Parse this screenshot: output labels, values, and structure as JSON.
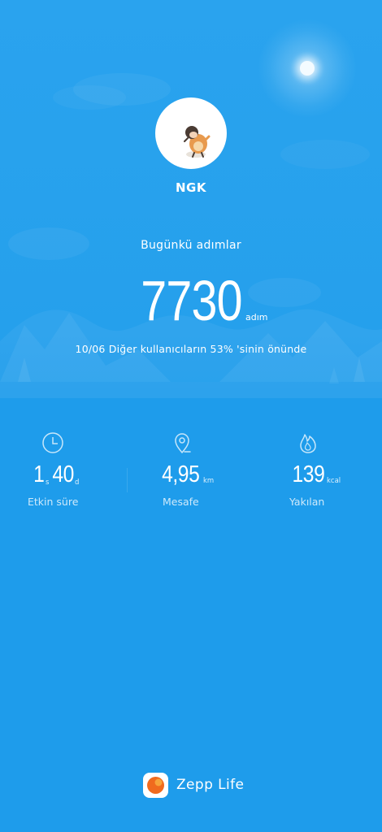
{
  "profile": {
    "username": "NGK"
  },
  "steps": {
    "label": "Bugünkü adımlar",
    "value": "7730",
    "unit": "adım",
    "comparison": "10/06 Diğer kullanıcıların 53% 'sinin önünde"
  },
  "stats": {
    "active_time": {
      "hours": "1",
      "hours_unit": "s",
      "minutes": "40",
      "minutes_unit": "d",
      "label": "Etkin süre",
      "icon": "clock-icon"
    },
    "distance": {
      "value": "4,95",
      "unit": "km",
      "label": "Mesafe",
      "icon": "location-pin-icon"
    },
    "calories": {
      "value": "139",
      "unit": "kcal",
      "label": "Yakılan",
      "icon": "flame-icon"
    }
  },
  "footer": {
    "app_name": "Zepp Life"
  },
  "colors": {
    "background": "#1e9ceb",
    "text": "#ffffff",
    "logo_orange": "#f06a1e"
  }
}
